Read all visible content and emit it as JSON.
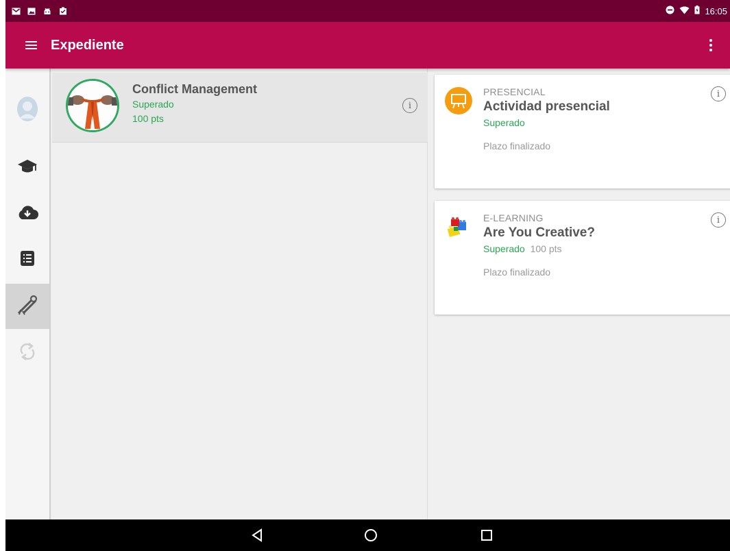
{
  "status_bar": {
    "time": "16:05",
    "left_icons": [
      "gmail-icon",
      "image-icon",
      "android-icon",
      "clipboard-check-icon"
    ],
    "right_icons": [
      "do-not-disturb-icon",
      "wifi-icon",
      "battery-charging-icon"
    ]
  },
  "app_bar": {
    "title": "Expediente",
    "color": "#b80a4c"
  },
  "left_rail": {
    "items": [
      {
        "icon": "avatar-icon"
      },
      {
        "icon": "graduation-cap-icon"
      },
      {
        "icon": "cloud-download-icon"
      },
      {
        "icon": "list-document-icon"
      },
      {
        "icon": "diploma-ribbon-icon",
        "active": true
      },
      {
        "icon": "sync-icon"
      }
    ]
  },
  "course": {
    "title": "Conflict Management",
    "status": "Superado",
    "points": "100 pts",
    "thumbnail": "tug-of-war-rope-image"
  },
  "activities": [
    {
      "type": "PRESENCIAL",
      "title": "Actividad presencial",
      "status": "Superado",
      "points": "",
      "deadline": "Plazo finalizado",
      "icon": "presentation-board-icon"
    },
    {
      "type": "E-LEARNING",
      "title": "Are You Creative?",
      "status": "Superado",
      "points": "100 pts",
      "deadline": "Plazo finalizado",
      "icon": "lego-blocks-icon"
    }
  ],
  "colors": {
    "status_bar": "#6d0030",
    "success_green": "#2aa552",
    "presencial_orange": "#f59d0e"
  }
}
